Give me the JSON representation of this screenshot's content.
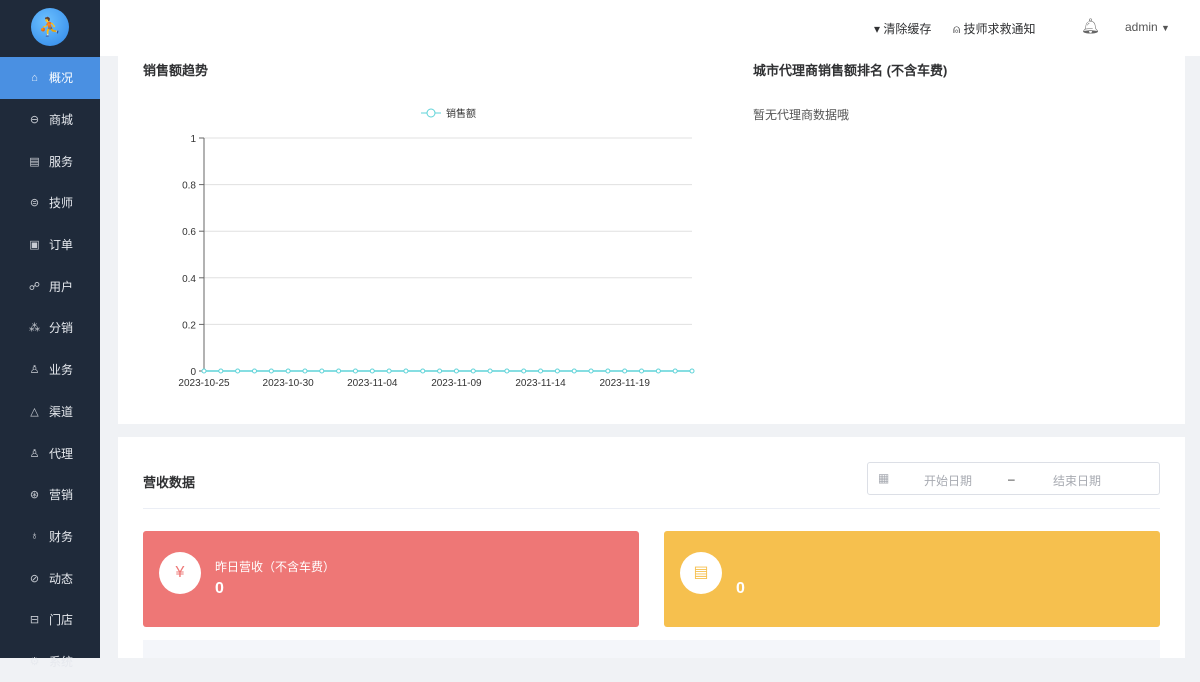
{
  "sidebar": {
    "items": [
      {
        "label": "概况",
        "icon": "home-icon",
        "glyph": "⌂"
      },
      {
        "label": "商城",
        "icon": "shop-icon",
        "glyph": "⊖"
      },
      {
        "label": "服务",
        "icon": "service-icon",
        "glyph": "▤"
      },
      {
        "label": "技师",
        "icon": "technician-icon",
        "glyph": "⊜"
      },
      {
        "label": "订单",
        "icon": "order-icon",
        "glyph": "▣"
      },
      {
        "label": "用户",
        "icon": "users-icon",
        "glyph": "☍"
      },
      {
        "label": "分销",
        "icon": "distribution-icon",
        "glyph": "⁂"
      },
      {
        "label": "业务",
        "icon": "business-icon",
        "glyph": "♙"
      },
      {
        "label": "渠道",
        "icon": "channel-icon",
        "glyph": "△"
      },
      {
        "label": "代理",
        "icon": "agent-icon",
        "glyph": "♙"
      },
      {
        "label": "营销",
        "icon": "marketing-icon",
        "glyph": "⊛"
      },
      {
        "label": "财务",
        "icon": "finance-icon",
        "glyph": "♁"
      },
      {
        "label": "动态",
        "icon": "news-icon",
        "glyph": "⊘"
      },
      {
        "label": "门店",
        "icon": "store-icon",
        "glyph": "⊟"
      },
      {
        "label": "系统",
        "icon": "settings-icon",
        "glyph": "⚙"
      }
    ]
  },
  "header": {
    "clear_cache": "清除缓存",
    "sos_notice": "技师求救通知",
    "user": "admin"
  },
  "sales": {
    "title": "销售额趋势",
    "legend": "销售额"
  },
  "ranking": {
    "title": "城市代理商销售额排名 (不含车费)",
    "empty": "暂无代理商数据哦"
  },
  "revenue": {
    "title": "营收数据",
    "start_placeholder": "开始日期",
    "end_placeholder": "结束日期",
    "separator": "–",
    "cards": [
      {
        "label": "昨日营收（不含车费）",
        "value": "0",
        "color": "#ee7776"
      },
      {
        "label": "",
        "value": "0",
        "color": "#f6c04e"
      }
    ]
  },
  "chart_data": {
    "type": "line",
    "title": "销售额趋势",
    "legend": [
      "销售额"
    ],
    "x": [
      "2023-10-25",
      "2023-10-26",
      "2023-10-27",
      "2023-10-28",
      "2023-10-29",
      "2023-10-30",
      "2023-10-31",
      "2023-11-01",
      "2023-11-02",
      "2023-11-03",
      "2023-11-04",
      "2023-11-05",
      "2023-11-06",
      "2023-11-07",
      "2023-11-08",
      "2023-11-09",
      "2023-11-10",
      "2023-11-11",
      "2023-11-12",
      "2023-11-13",
      "2023-11-14",
      "2023-11-15",
      "2023-11-16",
      "2023-11-17",
      "2023-11-18",
      "2023-11-19",
      "2023-11-20",
      "2023-11-21",
      "2023-11-22",
      "2023-11-23"
    ],
    "xticks": [
      "2023-10-25",
      "2023-10-30",
      "2023-11-04",
      "2023-11-09",
      "2023-11-14",
      "2023-11-19"
    ],
    "series": [
      {
        "name": "销售额",
        "values": [
          0,
          0,
          0,
          0,
          0,
          0,
          0,
          0,
          0,
          0,
          0,
          0,
          0,
          0,
          0,
          0,
          0,
          0,
          0,
          0,
          0,
          0,
          0,
          0,
          0,
          0,
          0,
          0,
          0,
          0
        ]
      }
    ],
    "ylim": [
      0,
      1
    ],
    "yticks": [
      "0",
      "0.2",
      "0.4",
      "0.6",
      "0.8",
      "1"
    ],
    "color": "#5fd3d8",
    "grid": true
  }
}
